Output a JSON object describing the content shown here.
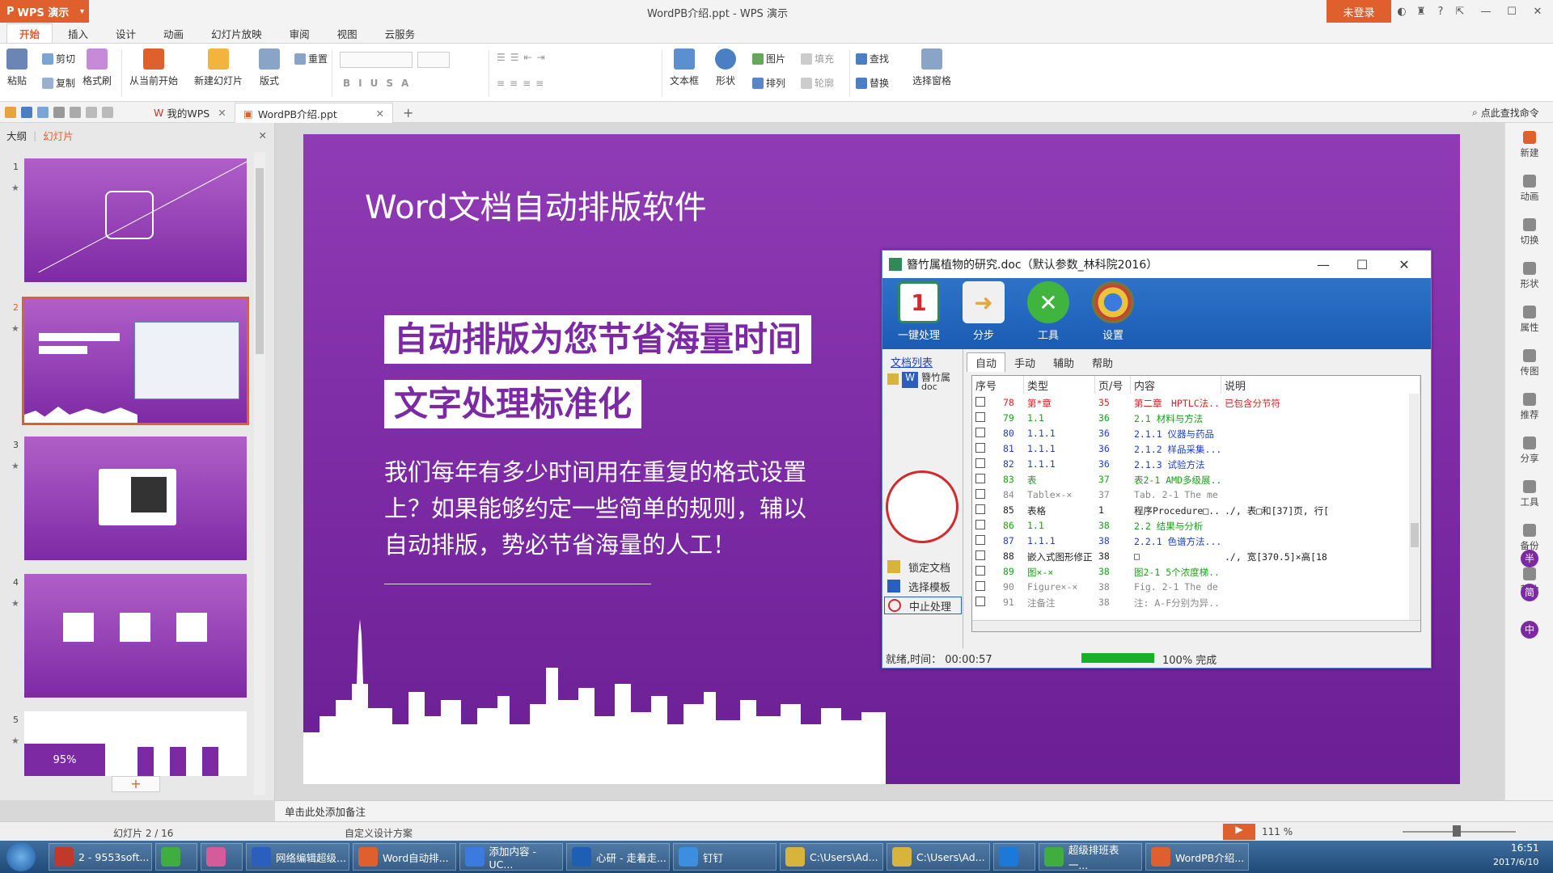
{
  "app": {
    "name": "WPS 演示",
    "doc_title": "WordPB介绍.ppt - WPS 演示",
    "login": "未登录",
    "title_icons": [
      "skin-icon",
      "shirt-icon",
      "help-icon",
      "restore-icon",
      "minimize-icon",
      "maximize-icon",
      "close-icon"
    ]
  },
  "ribbon_tabs": [
    "开始",
    "插入",
    "设计",
    "动画",
    "幻灯片放映",
    "审阅",
    "视图",
    "云服务"
  ],
  "ribbon": {
    "paste": "粘贴",
    "cut": "剪切",
    "copy": "复制",
    "format_painter": "格式刷",
    "from_current": "从当前开始",
    "new_slide": "新建幻灯片",
    "layout": "版式",
    "reset": "重置",
    "text_box": "文本框",
    "shape": "形状",
    "picture": "图片",
    "arrange": "排列",
    "fill": "填充",
    "outline": "轮廓",
    "find": "查找",
    "replace": "替换",
    "select_pane": "选择窗格"
  },
  "doc_tabs": {
    "my_wps": "我的WPS",
    "current": "WordPB介绍.ppt",
    "find_cmd": "点此查找命令"
  },
  "left_panel": {
    "outline_tab": "大纲",
    "slides_tab": "幻灯片",
    "numbers": [
      "1",
      "2",
      "3",
      "4",
      "5"
    ],
    "thumb5_pct": "95%"
  },
  "slide": {
    "title": "Word文档自动排版软件",
    "headline1": "自动排版为您节省海量时间",
    "headline2": "文字处理标准化",
    "body": "我们每年有多少时间用在重复的格式设置上？如果能够约定一些简单的规则，辅以自动排版，势必节省海量的人工！"
  },
  "app_window": {
    "title": "簪竹属植物的研究.doc（默认参数_林科院2016）",
    "tools": [
      "一键处理",
      "分步",
      "工具",
      "设置"
    ],
    "doc_list_label": "文档列表",
    "doc_name": "簪竹属",
    "doc_ext": "doc",
    "side_buttons": [
      "锁定文档",
      "选择模板",
      "中止处理"
    ],
    "tabs": [
      "自动",
      "手动",
      "辅助",
      "帮助"
    ],
    "columns": [
      "序号",
      "类型",
      "页/号",
      "内容",
      "说明"
    ],
    "rows": [
      {
        "no": "78",
        "type": "第*章",
        "page": "35",
        "content": "第二章　HPTLC法...",
        "note": "已包含分节符",
        "color": "#e02020"
      },
      {
        "no": "79",
        "type": "1.1",
        "page": "36",
        "content": "2.1 材料与方法",
        "note": "",
        "color": "#16a316"
      },
      {
        "no": "80",
        "type": "1.1.1",
        "page": "36",
        "content": "2.1.1 仪器与药品",
        "note": "",
        "color": "#1d3fd1"
      },
      {
        "no": "81",
        "type": "1.1.1",
        "page": "36",
        "content": "2.1.2 样品采集...",
        "note": "",
        "color": "#1d3fd1"
      },
      {
        "no": "82",
        "type": "1.1.1",
        "page": "36",
        "content": "2.1.3 试验方法",
        "note": "",
        "color": "#1d3fd1"
      },
      {
        "no": "83",
        "type": "表",
        "page": "37",
        "content": "表2-1 AMD多级展...",
        "note": "",
        "color": "#16a316"
      },
      {
        "no": "84",
        "type": "Table×-×",
        "page": "37",
        "content": "Tab. 2-1 The me...",
        "note": "",
        "color": "#888888"
      },
      {
        "no": "85",
        "type": "表格",
        "page": "1",
        "content": "程序Procedure□...",
        "note": "./, 表□和[37]页, 行[",
        "color": "#222222"
      },
      {
        "no": "86",
        "type": "1.1",
        "page": "38",
        "content": "2.2 结果与分析",
        "note": "",
        "color": "#16a316"
      },
      {
        "no": "87",
        "type": "1.1.1",
        "page": "38",
        "content": "2.2.1 色谱方法...",
        "note": "",
        "color": "#1d3fd1"
      },
      {
        "no": "88",
        "type": "嵌入式图形修正",
        "page": "38",
        "content": "□",
        "note": "./, 宽[370.5]×高[18",
        "color": "#222222"
      },
      {
        "no": "89",
        "type": "图×-×",
        "page": "38",
        "content": "图2-1 5个浓度梯...",
        "note": "",
        "color": "#16a316"
      },
      {
        "no": "90",
        "type": "Figure×-×",
        "page": "38",
        "content": "Fig. 2-1 The de...",
        "note": "",
        "color": "#888888"
      },
      {
        "no": "91",
        "type": "注备注",
        "page": "38",
        "content": "注: A-F分别为异...",
        "note": "",
        "color": "#888888"
      }
    ],
    "status_text": "就绪,时间：  00:00:57",
    "progress": 100,
    "progress_label": "100%  完成"
  },
  "right_strip": [
    "新建",
    "动画",
    "切换",
    "形状",
    "属性",
    "传图",
    "推荐",
    "分享",
    "工具",
    "备份",
    "帮助"
  ],
  "float_buttons": [
    "半",
    "简",
    "中"
  ],
  "notes_placeholder": "单击此处添加备注",
  "status": {
    "slide_count": "幻灯片 2 / 16",
    "design": "自定义设计方案",
    "zoom": "111 %"
  },
  "taskbar": {
    "items": [
      "2 - 9553soft...",
      "",
      "",
      "网络编辑超级...",
      "Word自动排...",
      "添加内容 - UC...",
      "心研 - 走着走...",
      "钉钉",
      "C:\\Users\\Ad...",
      "C:\\Users\\Ad...",
      "",
      "超级排班表 一...",
      "WordPB介绍..."
    ],
    "clock": "16:51",
    "date": "2017/6/10"
  },
  "colors": {
    "accent": "#e0602d",
    "slide_purple": "#7b2aa3",
    "titlebar": "#f3f3f3"
  }
}
